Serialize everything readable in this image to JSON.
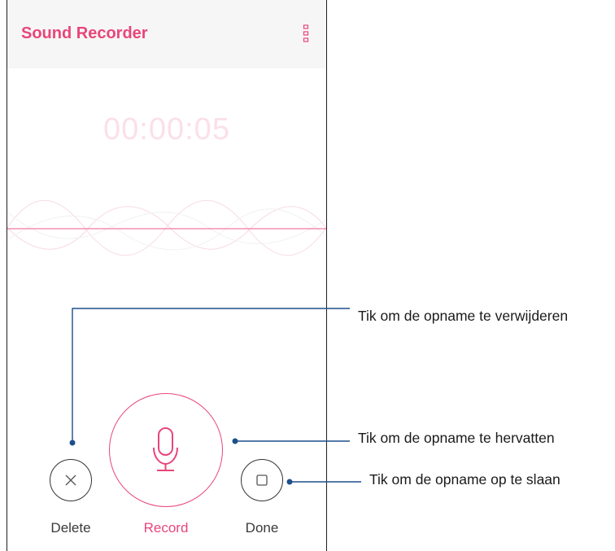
{
  "app": {
    "title": "Sound Recorder",
    "menu_icon": "more-vertical-icon"
  },
  "recorder": {
    "elapsed_time": "00:00:05",
    "waveform_icon": "sound-wave"
  },
  "controls": {
    "delete_label": "Delete",
    "delete_icon": "close-icon",
    "record_label": "Record",
    "record_icon": "microphone-icon",
    "done_label": "Done",
    "done_icon": "stop-icon"
  },
  "callouts": {
    "delete": "Tik om de opname te verwijderen",
    "record": "Tik om de opname te hervatten",
    "done": "Tik om de opname op te slaan"
  },
  "colors": {
    "accent": "#e8467a",
    "timer": "#fbe0e9",
    "appbar_bg": "#f6f6f6",
    "callout_line": "#1d4f8c"
  }
}
